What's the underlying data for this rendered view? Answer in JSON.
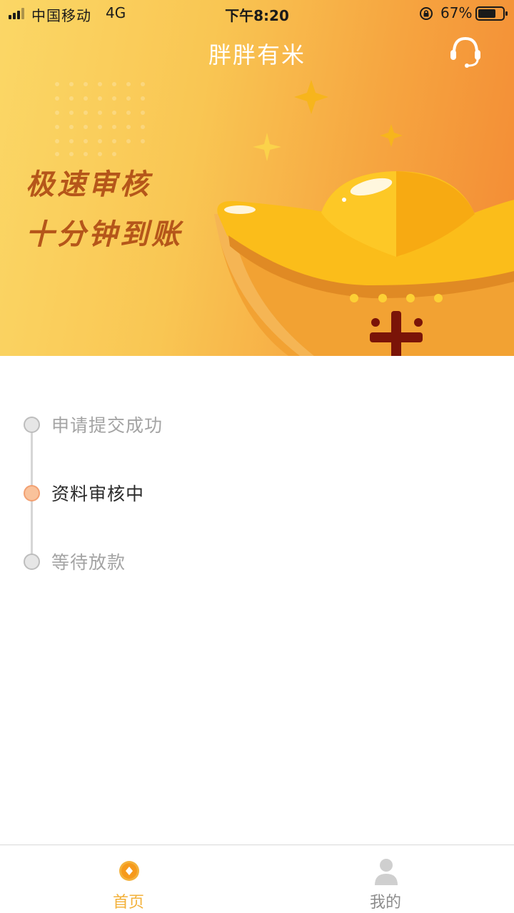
{
  "status_bar": {
    "carrier": "中国移动",
    "network": "4G",
    "time": "下午8:20",
    "battery": "67%"
  },
  "nav": {
    "title": "胖胖有米",
    "service_icon": "headset-icon"
  },
  "banner": {
    "slogan_line1": "极速审核",
    "slogan_line2": "十分钟到账",
    "illustration": "gold-ingot-icon"
  },
  "progress": {
    "steps": [
      {
        "label": "申请提交成功",
        "state": "done"
      },
      {
        "label": "资料审核中",
        "state": "active"
      },
      {
        "label": "等待放款",
        "state": "pending"
      }
    ]
  },
  "tab_bar": {
    "items": [
      {
        "label": "首页",
        "icon": "home-coin-icon",
        "selected": true
      },
      {
        "label": "我的",
        "icon": "user-icon",
        "selected": false
      }
    ]
  },
  "colors": {
    "accent": "#f3b13a",
    "active_step": "#f9c29b",
    "slogan": "#b5561a"
  }
}
